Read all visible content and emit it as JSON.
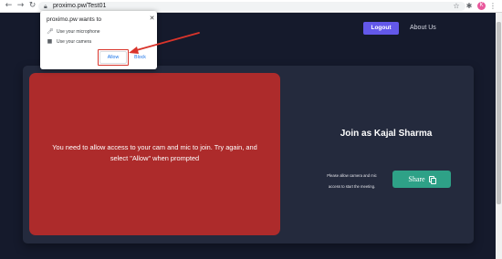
{
  "browser": {
    "back_icon": "back-arrow-icon",
    "forward_icon": "forward-arrow-icon",
    "reload_icon": "reload-icon",
    "url": "proximo.pw/Test01",
    "profile_initial": "K",
    "extension_icon": "puzzle-icon",
    "star_icon": "star-icon",
    "menu_icon": "kebab-menu-icon"
  },
  "header": {
    "logout_label": "Logout",
    "about_label": "About Us"
  },
  "permission_popup": {
    "title": "proximo.pw wants to",
    "permissions": [
      {
        "icon": "microphone-icon",
        "label": "Use your microphone"
      },
      {
        "icon": "camera-icon",
        "label": "Use your camera"
      }
    ],
    "allow_label": "Allow",
    "block_label": "Block"
  },
  "meeting": {
    "video_message": "You need to allow access to your cam and mic to join. Try again, and select \"Allow\" when prompted",
    "join_title": "Join as Kajal Sharma",
    "instruction": "Please allow camera and mic access to start the meeting.",
    "share_label": "Share"
  },
  "colors": {
    "page_bg": "#151a2c",
    "card_bg": "#242a3d",
    "video_error_bg": "#ad2b2b",
    "logout_bg": "#6358e9",
    "share_bg": "#2ea187",
    "annotation": "#d9342b"
  }
}
